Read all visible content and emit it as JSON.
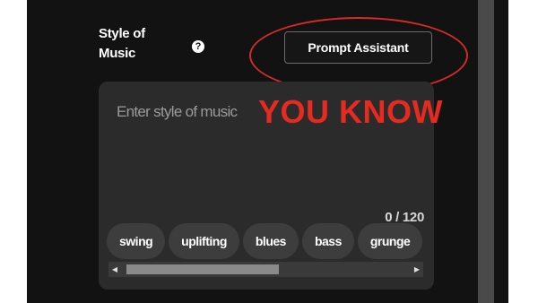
{
  "form": {
    "style_label": "Style of Music",
    "help_icon": "question-circle-icon",
    "prompt_assistant_label": "Prompt Assistant",
    "style_input_placeholder": "Enter style of music",
    "char_counter": "0 / 120",
    "tags": [
      "swing",
      "uplifting",
      "blues",
      "bass",
      "grunge"
    ]
  },
  "annotation": {
    "text": "YOU KNOW",
    "color": "#e52a1f"
  },
  "colors": {
    "background": "#121212",
    "card": "#2b2b2b",
    "tag": "#3d3d3d",
    "annotation_red": "#d42a2a"
  }
}
